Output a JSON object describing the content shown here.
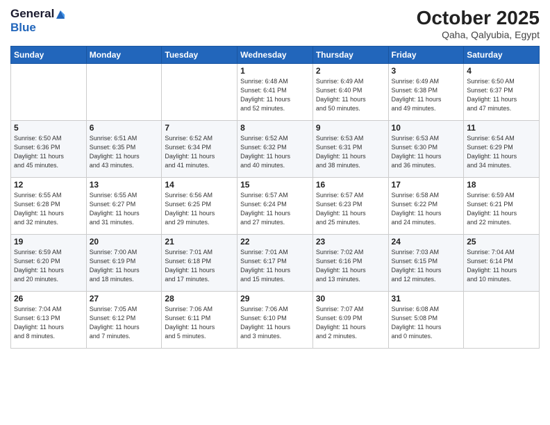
{
  "header": {
    "logo_line1": "General",
    "logo_line2": "Blue",
    "month": "October 2025",
    "location": "Qaha, Qalyubia, Egypt"
  },
  "days_of_week": [
    "Sunday",
    "Monday",
    "Tuesday",
    "Wednesday",
    "Thursday",
    "Friday",
    "Saturday"
  ],
  "weeks": [
    [
      {
        "day": "",
        "info": ""
      },
      {
        "day": "",
        "info": ""
      },
      {
        "day": "",
        "info": ""
      },
      {
        "day": "1",
        "info": "Sunrise: 6:48 AM\nSunset: 6:41 PM\nDaylight: 11 hours\nand 52 minutes."
      },
      {
        "day": "2",
        "info": "Sunrise: 6:49 AM\nSunset: 6:40 PM\nDaylight: 11 hours\nand 50 minutes."
      },
      {
        "day": "3",
        "info": "Sunrise: 6:49 AM\nSunset: 6:38 PM\nDaylight: 11 hours\nand 49 minutes."
      },
      {
        "day": "4",
        "info": "Sunrise: 6:50 AM\nSunset: 6:37 PM\nDaylight: 11 hours\nand 47 minutes."
      }
    ],
    [
      {
        "day": "5",
        "info": "Sunrise: 6:50 AM\nSunset: 6:36 PM\nDaylight: 11 hours\nand 45 minutes."
      },
      {
        "day": "6",
        "info": "Sunrise: 6:51 AM\nSunset: 6:35 PM\nDaylight: 11 hours\nand 43 minutes."
      },
      {
        "day": "7",
        "info": "Sunrise: 6:52 AM\nSunset: 6:34 PM\nDaylight: 11 hours\nand 41 minutes."
      },
      {
        "day": "8",
        "info": "Sunrise: 6:52 AM\nSunset: 6:32 PM\nDaylight: 11 hours\nand 40 minutes."
      },
      {
        "day": "9",
        "info": "Sunrise: 6:53 AM\nSunset: 6:31 PM\nDaylight: 11 hours\nand 38 minutes."
      },
      {
        "day": "10",
        "info": "Sunrise: 6:53 AM\nSunset: 6:30 PM\nDaylight: 11 hours\nand 36 minutes."
      },
      {
        "day": "11",
        "info": "Sunrise: 6:54 AM\nSunset: 6:29 PM\nDaylight: 11 hours\nand 34 minutes."
      }
    ],
    [
      {
        "day": "12",
        "info": "Sunrise: 6:55 AM\nSunset: 6:28 PM\nDaylight: 11 hours\nand 32 minutes."
      },
      {
        "day": "13",
        "info": "Sunrise: 6:55 AM\nSunset: 6:27 PM\nDaylight: 11 hours\nand 31 minutes."
      },
      {
        "day": "14",
        "info": "Sunrise: 6:56 AM\nSunset: 6:25 PM\nDaylight: 11 hours\nand 29 minutes."
      },
      {
        "day": "15",
        "info": "Sunrise: 6:57 AM\nSunset: 6:24 PM\nDaylight: 11 hours\nand 27 minutes."
      },
      {
        "day": "16",
        "info": "Sunrise: 6:57 AM\nSunset: 6:23 PM\nDaylight: 11 hours\nand 25 minutes."
      },
      {
        "day": "17",
        "info": "Sunrise: 6:58 AM\nSunset: 6:22 PM\nDaylight: 11 hours\nand 24 minutes."
      },
      {
        "day": "18",
        "info": "Sunrise: 6:59 AM\nSunset: 6:21 PM\nDaylight: 11 hours\nand 22 minutes."
      }
    ],
    [
      {
        "day": "19",
        "info": "Sunrise: 6:59 AM\nSunset: 6:20 PM\nDaylight: 11 hours\nand 20 minutes."
      },
      {
        "day": "20",
        "info": "Sunrise: 7:00 AM\nSunset: 6:19 PM\nDaylight: 11 hours\nand 18 minutes."
      },
      {
        "day": "21",
        "info": "Sunrise: 7:01 AM\nSunset: 6:18 PM\nDaylight: 11 hours\nand 17 minutes."
      },
      {
        "day": "22",
        "info": "Sunrise: 7:01 AM\nSunset: 6:17 PM\nDaylight: 11 hours\nand 15 minutes."
      },
      {
        "day": "23",
        "info": "Sunrise: 7:02 AM\nSunset: 6:16 PM\nDaylight: 11 hours\nand 13 minutes."
      },
      {
        "day": "24",
        "info": "Sunrise: 7:03 AM\nSunset: 6:15 PM\nDaylight: 11 hours\nand 12 minutes."
      },
      {
        "day": "25",
        "info": "Sunrise: 7:04 AM\nSunset: 6:14 PM\nDaylight: 11 hours\nand 10 minutes."
      }
    ],
    [
      {
        "day": "26",
        "info": "Sunrise: 7:04 AM\nSunset: 6:13 PM\nDaylight: 11 hours\nand 8 minutes."
      },
      {
        "day": "27",
        "info": "Sunrise: 7:05 AM\nSunset: 6:12 PM\nDaylight: 11 hours\nand 7 minutes."
      },
      {
        "day": "28",
        "info": "Sunrise: 7:06 AM\nSunset: 6:11 PM\nDaylight: 11 hours\nand 5 minutes."
      },
      {
        "day": "29",
        "info": "Sunrise: 7:06 AM\nSunset: 6:10 PM\nDaylight: 11 hours\nand 3 minutes."
      },
      {
        "day": "30",
        "info": "Sunrise: 7:07 AM\nSunset: 6:09 PM\nDaylight: 11 hours\nand 2 minutes."
      },
      {
        "day": "31",
        "info": "Sunrise: 6:08 AM\nSunset: 5:08 PM\nDaylight: 11 hours\nand 0 minutes."
      },
      {
        "day": "",
        "info": ""
      }
    ]
  ]
}
